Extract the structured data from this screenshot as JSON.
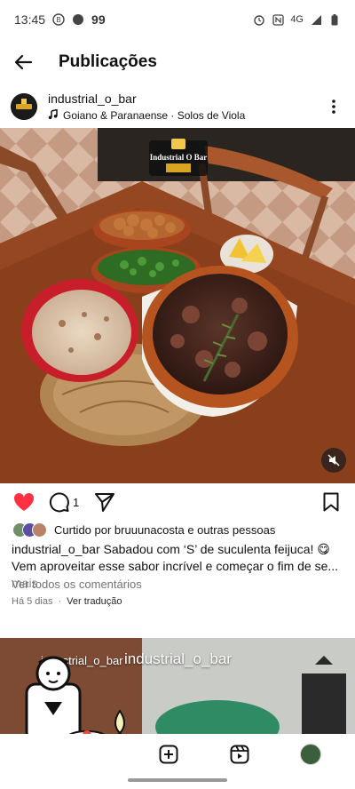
{
  "status": {
    "time": "13:45",
    "notif_count": "99",
    "network": "4G"
  },
  "appbar": {
    "title": "Publicações"
  },
  "post": {
    "username": "industrial_o_bar",
    "music": "Goiano & Paranaense · Solos de Viola",
    "logo_text": "Industrial O Bar",
    "comment_count": "1",
    "liked_by": "Curtido por bruuunacosta e outras pessoas",
    "caption_user": "industrial_o_bar",
    "caption_text": " Sabadou com ‘S’ de suculenta feijuca! 😋 Vem aproveitar esse sabor incrível e começar o fim de se...",
    "caption_more": " mais",
    "view_comments": "Ver todos os comentários",
    "time_ago": "Há 5 dias",
    "translate": "Ver tradução"
  },
  "next_post": {
    "username": "industrial_o_bar",
    "overlay": "industrial_o_bar"
  },
  "icons": {
    "back": "arrow-left-icon",
    "more": "more-vertical-icon",
    "like": "heart-icon",
    "comment": "comment-icon",
    "share": "send-icon",
    "save": "bookmark-icon",
    "mute": "mute-icon",
    "add": "add-icon",
    "reels": "reels-icon"
  },
  "colors": {
    "like": "#ff3040",
    "secondary_text": "#737373"
  }
}
